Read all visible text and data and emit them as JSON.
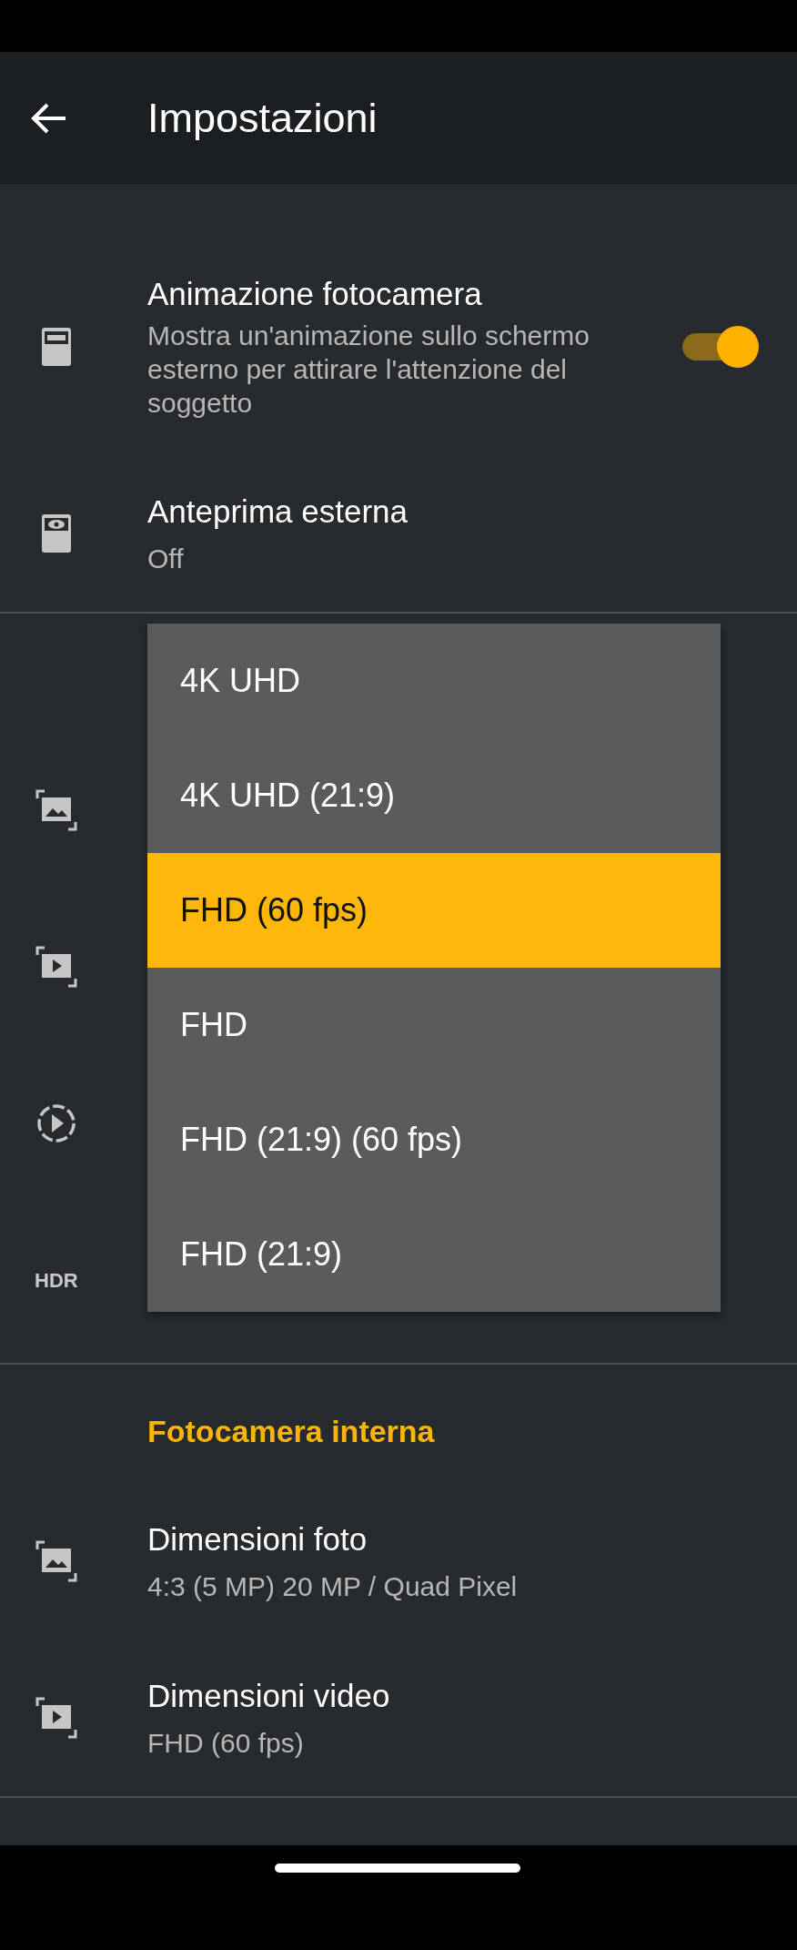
{
  "app_bar": {
    "title": "Impostazioni"
  },
  "settings": [
    {
      "kind": "switch",
      "title": "Animazione fotocamera",
      "description": "Mostra un'animazione sullo schermo esterno per attirare l'attenzione del soggetto",
      "on": true
    },
    {
      "kind": "value",
      "title": "Anteprima esterna",
      "value": "Off"
    }
  ],
  "covered_rows": {
    "hdr_label": "HDR"
  },
  "dropdown": {
    "options": [
      {
        "label": "4K UHD",
        "selected": false
      },
      {
        "label": "4K UHD (21:9)",
        "selected": false
      },
      {
        "label": "FHD (60 fps)",
        "selected": true
      },
      {
        "label": "FHD",
        "selected": false
      },
      {
        "label": "FHD (21:9) (60 fps)",
        "selected": false
      },
      {
        "label": "FHD (21:9)",
        "selected": false
      }
    ]
  },
  "section": {
    "header": "Fotocamera interna",
    "items": [
      {
        "title": "Dimensioni foto",
        "value": "4:3 (5 MP) 20 MP / Quad Pixel"
      },
      {
        "title": "Dimensioni video",
        "value": "FHD (60 fps)"
      }
    ]
  }
}
